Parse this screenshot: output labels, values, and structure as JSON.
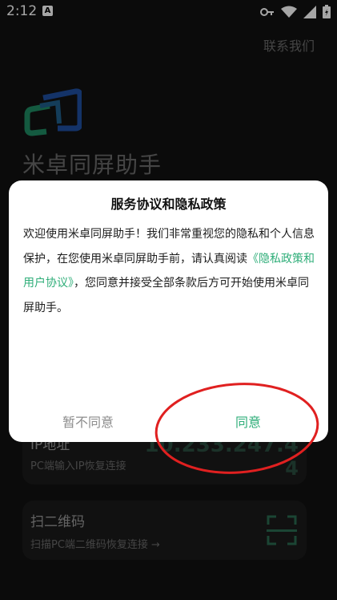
{
  "status_bar": {
    "time": "2:12",
    "notification_glyph": "A",
    "icons": [
      "key-icon",
      "wifi-icon",
      "signal-icon",
      "battery-icon"
    ]
  },
  "header": {
    "contact": "联系我们"
  },
  "app": {
    "title": "米卓同屏助手"
  },
  "ip_card": {
    "title": "IP地址",
    "subtitle": "PC端输入IP恢复连接",
    "ip_line1": "10.233.247.4",
    "ip_line2": "4"
  },
  "qr_card": {
    "title": "扫二维码",
    "subtitle": "扫描PC端二维码恢复连接 →"
  },
  "dialog": {
    "title": "服务协议和隐私政策",
    "body_before": "欢迎使用米卓同屏助手！我们非常重视您的隐私和个人信息保护，在您使用米卓同屏助手前，请认真阅读",
    "link": "《隐私政策和用户协议》",
    "body_after": "，您同意并接受全部条款后方可开始使用米卓同屏助手。",
    "decline": "暂不同意",
    "agree": "同意"
  },
  "colors": {
    "accent": "#2fae79",
    "annotation": "#e02020",
    "background": "#111111"
  }
}
